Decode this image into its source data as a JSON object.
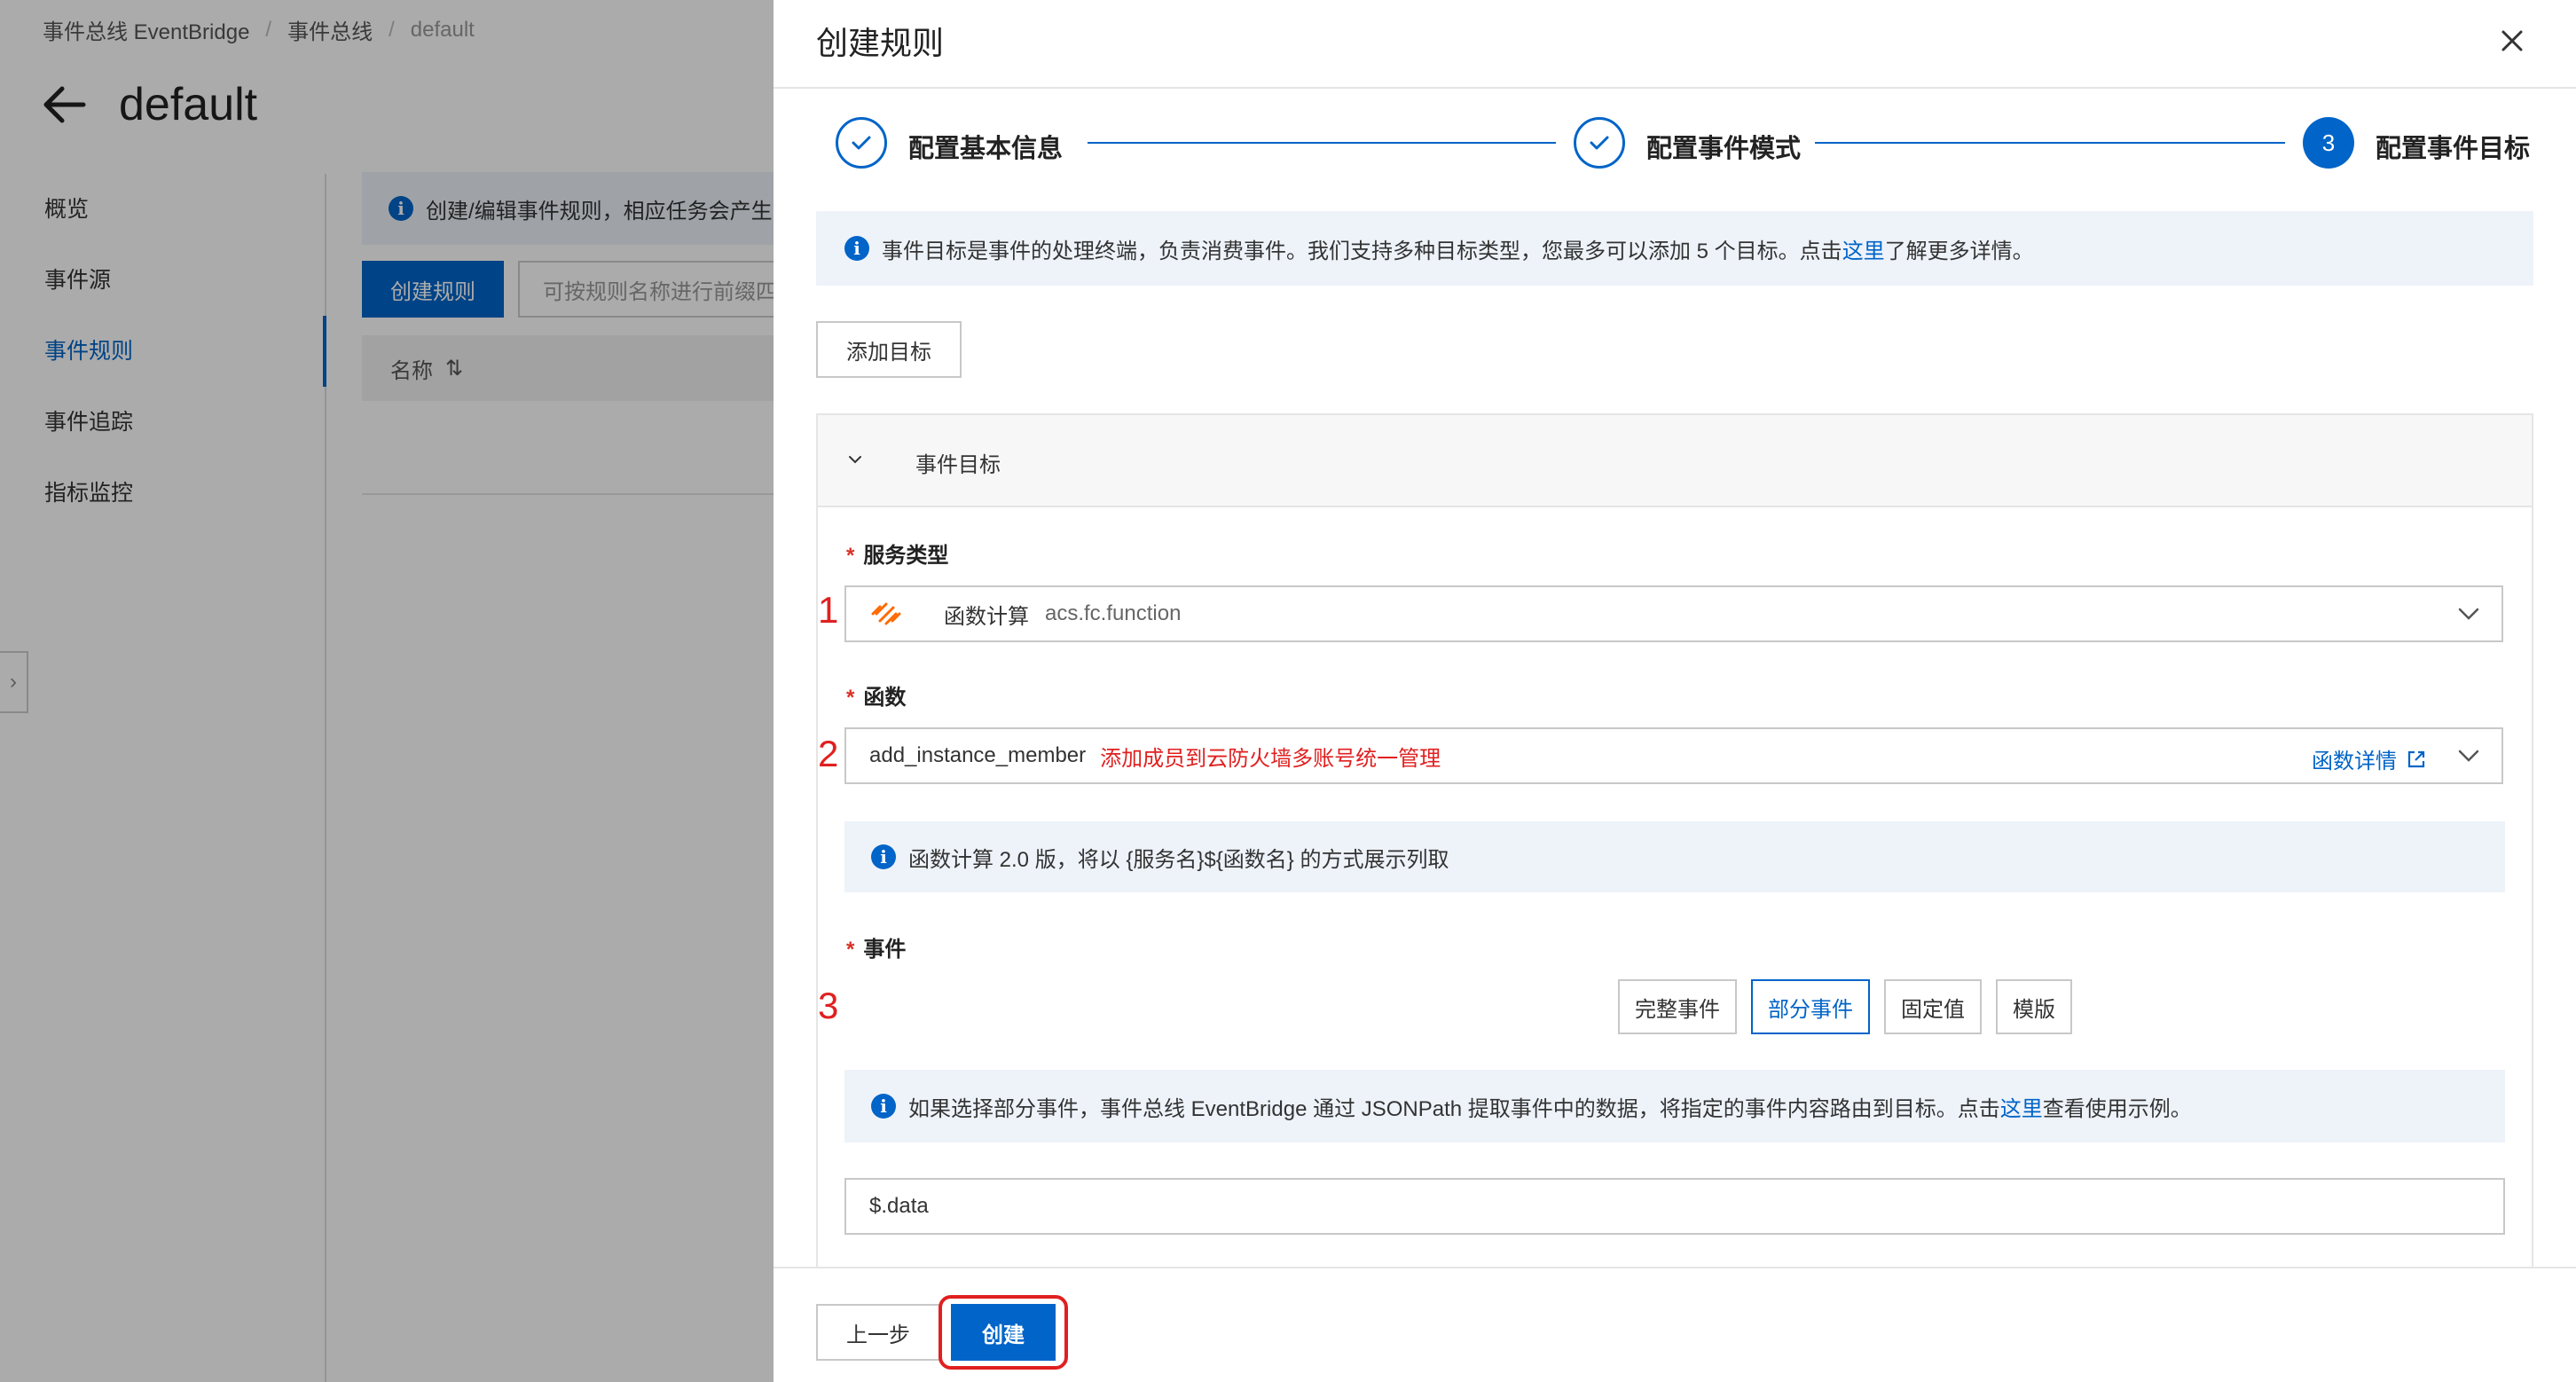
{
  "background": {
    "breadcrumb": [
      "事件总线 EventBridge",
      "事件总线",
      "default"
    ],
    "page_title": "default",
    "nav": [
      "概览",
      "事件源",
      "事件规则",
      "事件追踪",
      "指标监控"
    ],
    "active_nav_index": 2,
    "tip": "创建/编辑事件规则，相应任务会产生",
    "create_button": "创建规则",
    "search_placeholder": "可按规则名称进行前缀四",
    "table_header_name": "名称",
    "sort_icon": "⇅"
  },
  "drawer": {
    "title": "创建规则",
    "steps": [
      {
        "label": "配置基本信息",
        "state": "done"
      },
      {
        "label": "配置事件模式",
        "state": "done"
      },
      {
        "label": "配置事件目标",
        "state": "current",
        "number": "3"
      }
    ],
    "target_tip": {
      "before": "事件目标是事件的处理终端，负责消费事件。我们支持多种目标类型，您最多可以添加 5 个目标。点击",
      "link": "这里",
      "after": "了解更多详情。"
    },
    "add_target_button": "添加目标",
    "panel_title": "事件目标",
    "service_type": {
      "label": "服务类型",
      "value_name": "函数计算",
      "value_code": "acs.fc.function",
      "annotation": "1"
    },
    "function": {
      "label": "函数",
      "value": "add_instance_member",
      "note": "添加成员到云防火墙多账号统一管理",
      "detail_link": "函数详情",
      "annotation": "2"
    },
    "fc_tip": "函数计算 2.0 版，将以 {服务名}${函数名} 的方式展示列取",
    "event": {
      "label": "事件",
      "options": [
        "完整事件",
        "部分事件",
        "固定值",
        "模版"
      ],
      "selected_index": 1,
      "annotation": "3"
    },
    "partial_tip": {
      "before": "如果选择部分事件，事件总线 EventBridge 通过 JSONPath 提取事件中的数据，将指定的事件内容路由到目标。点击",
      "link": "这里",
      "after": "查看使用示例。"
    },
    "jsonpath_value": "$.data",
    "footer": {
      "prev_button": "上一步",
      "create_button": "创建"
    }
  },
  "colors": {
    "primary": "#0064c8",
    "annotation_red": "#e02020",
    "required_red": "#d93026"
  }
}
